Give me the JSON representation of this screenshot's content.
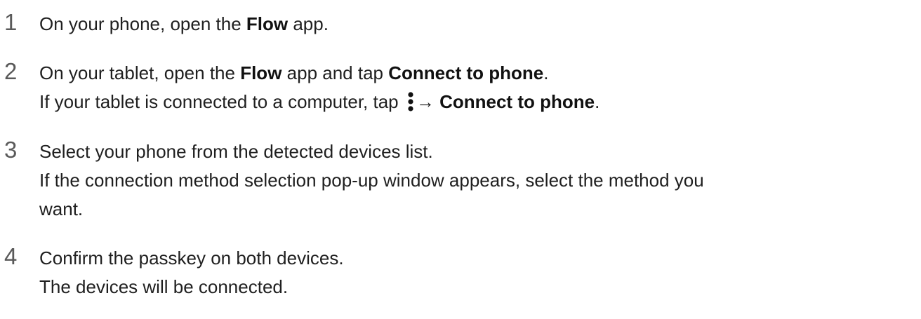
{
  "steps": [
    {
      "number": "1",
      "lines": [
        {
          "t1": "On your phone, open the ",
          "b1": "Flow",
          "t2": " app."
        }
      ]
    },
    {
      "number": "2",
      "lines": [
        {
          "t1": "On your tablet, open the ",
          "b1": "Flow",
          "t2": " app and tap ",
          "b2": "Connect to phone",
          "t3": "."
        },
        {
          "t1": "If your tablet is connected to a computer, tap ",
          "icon": "more-options-icon",
          "arrow": "→",
          "b1": "Connect to phone",
          "t2": "."
        }
      ]
    },
    {
      "number": "3",
      "lines": [
        {
          "t1": "Select your phone from the detected devices list."
        },
        {
          "t1": "If the connection method selection pop-up window appears, select the method you"
        },
        {
          "t1": "want."
        }
      ]
    },
    {
      "number": "4",
      "lines": [
        {
          "t1": "Confirm the passkey on both devices."
        },
        {
          "t1": "The devices will be connected."
        }
      ]
    }
  ]
}
